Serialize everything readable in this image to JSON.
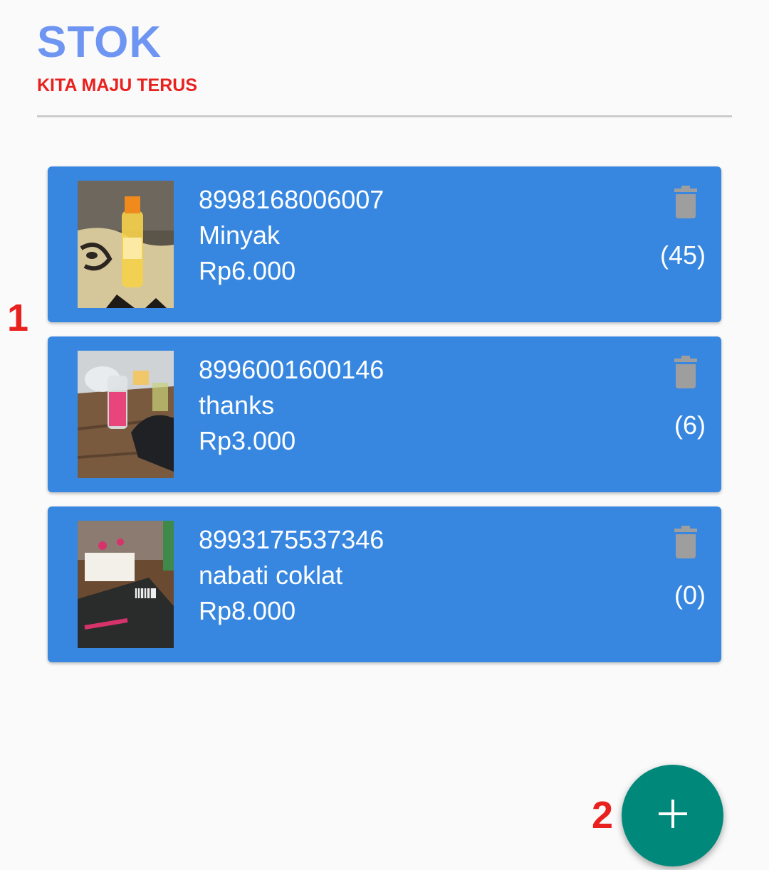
{
  "header": {
    "title": "STOK",
    "subtitle": "KITA MAJU TERUS"
  },
  "products": [
    {
      "barcode": "8998168006007",
      "name": "Minyak",
      "price": "Rp6.000",
      "quantity": "(45)",
      "delete_icon": "trash-icon"
    },
    {
      "barcode": "8996001600146",
      "name": "thanks",
      "price": "Rp3.000",
      "quantity": "(6)",
      "delete_icon": "trash-icon"
    },
    {
      "barcode": "8993175537346",
      "name": "nabati coklat",
      "price": "Rp8.000",
      "quantity": "(0)",
      "delete_icon": "trash-icon"
    }
  ],
  "annotations": {
    "marker_1": "1",
    "marker_2": "2"
  },
  "fab": {
    "icon": "plus-icon"
  },
  "colors": {
    "title": "#6f95f3",
    "subtitle": "#e8211f",
    "card": "#3787e0",
    "fab": "#00897b",
    "marker": "#e8211f",
    "trash": "#9e9e9e"
  }
}
